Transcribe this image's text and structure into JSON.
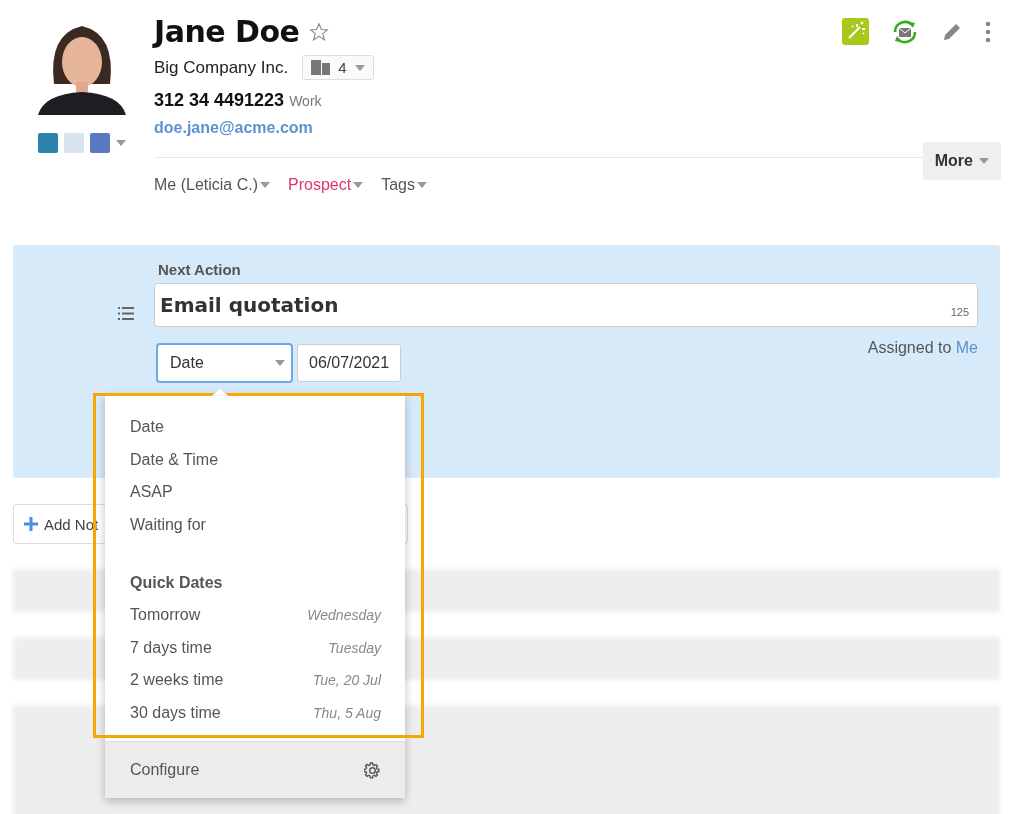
{
  "contact": {
    "name": "Jane Doe",
    "starred": false,
    "company": "Big Company Inc.",
    "company_count": "4",
    "phone": "312 34 4491223",
    "phone_label": "Work",
    "email": "doe.jane@acme.com"
  },
  "owner": "Me (Leticia C.)",
  "status": "Prospect",
  "tags": "Tags",
  "more": "More",
  "next_action": {
    "heading": "Next Action",
    "value": "Email quotation",
    "counter": "125",
    "date_type": "Date",
    "date": "06/07/2021",
    "assigned_label": "Assigned to",
    "assignee": "Me"
  },
  "add_button": "Add Not",
  "dropdown": {
    "options": [
      "Date",
      "Date & Time",
      "ASAP",
      "Waiting for"
    ],
    "quick_dates_heading": "Quick Dates",
    "quick_dates": [
      {
        "label": "Tomorrow",
        "day": "Wednesday"
      },
      {
        "label": "7 days time",
        "day": "Tuesday"
      },
      {
        "label": "2 weeks time",
        "day": "Tue, 20 Jul"
      },
      {
        "label": "30 days time",
        "day": "Thu, 5 Aug"
      }
    ],
    "configure": "Configure"
  }
}
